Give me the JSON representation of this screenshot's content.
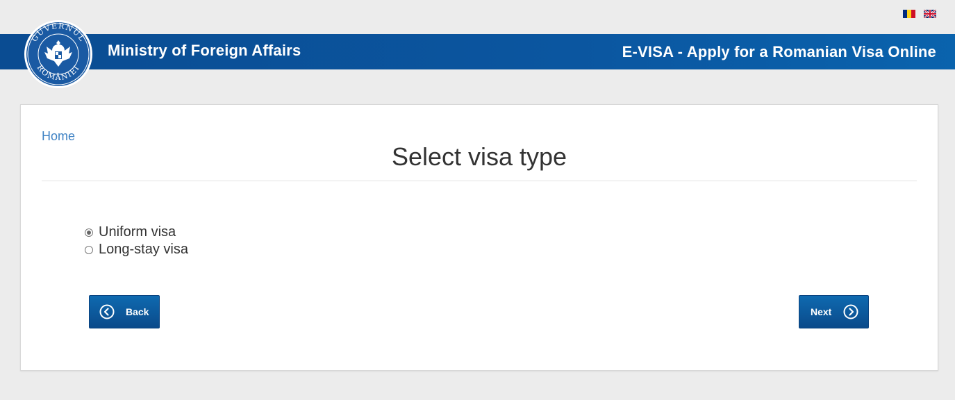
{
  "header": {
    "flags": [
      {
        "name": "romanian-flag-icon",
        "language": "Romanian"
      },
      {
        "name": "uk-flag-icon",
        "language": "English"
      }
    ],
    "emblem_text": "GUVERNUL ROMÂNIEI",
    "site_title": "Ministry of Foreign Affairs",
    "app_title": "E-VISA - Apply for a Romanian Visa Online",
    "colors": {
      "banner": "#0b56a0",
      "page_background": "#ececec"
    }
  },
  "main": {
    "breadcrumb_home": "Home",
    "title": "Select visa type",
    "visa_options": [
      {
        "label": "Uniform visa",
        "selected": true
      },
      {
        "label": "Long-stay visa",
        "selected": false
      }
    ],
    "back_label": "Back",
    "next_label": "Next",
    "colors": {
      "button": "#0a5596",
      "link": "#3f82c4"
    }
  }
}
